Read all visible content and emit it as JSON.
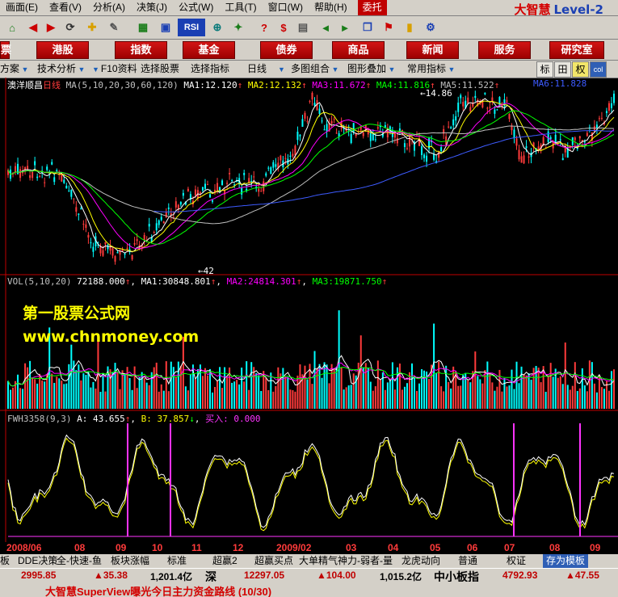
{
  "menu": {
    "items": [
      "画面(E)",
      "查看(V)",
      "分析(A)",
      "决策(J)",
      "公式(W)",
      "工具(T)",
      "窗口(W)",
      "帮助(H)"
    ],
    "entrust": "委托",
    "logo": "大智慧",
    "logo_level": "Level-2"
  },
  "toolbar": {
    "rsi_label": "RSI"
  },
  "navbar": {
    "left_stub": "票",
    "buttons": [
      "港股",
      "指数",
      "基金",
      "债券",
      "商品",
      "新闻",
      "服务",
      "研究室"
    ]
  },
  "function_bar": {
    "items": [
      "方案",
      "技术分析",
      "F10资料",
      "选择股票",
      "选择指标",
      "日线",
      "多图组合",
      "图形叠加",
      "常用指标"
    ],
    "buttons": [
      "标",
      "田",
      "权",
      "col"
    ]
  },
  "chart": {
    "stock_name": "澳洋顺昌",
    "period": "日线",
    "ma_params": "MA(5,10,20,30,60,120)",
    "ma_values": [
      {
        "label": "MA1:",
        "value": "12.120",
        "color": "#ffffff"
      },
      {
        "label": "MA2:",
        "value": "12.132",
        "color": "#ffff00"
      },
      {
        "label": "MA3:",
        "value": "11.672",
        "color": "#ff00ff"
      },
      {
        "label": "MA4:",
        "value": "11.816",
        "color": "#00ff00"
      },
      {
        "label": "MA5:",
        "value": "11.522",
        "color": "#c0c0c0"
      },
      {
        "label": "MA6:",
        "value": "11.828",
        "color": "#3d5bff"
      }
    ],
    "price_high_label": "14.86",
    "price_low_label": "42",
    "vol": {
      "params": "VOL(5,10,20)",
      "value": "72188.000",
      "ma1_label": "MA1:",
      "ma1": "30848.801",
      "ma2_label": "MA2:",
      "ma2": "24814.301",
      "ma3_label": "MA3:",
      "ma3": "19871.750"
    },
    "fwh": {
      "params": "FWH3358(9,3)",
      "a_label": "A:",
      "a": "43.655",
      "b_label": "B:",
      "b": "37.857",
      "buy_label": "买入:",
      "buy": "0.000"
    },
    "watermark_title": "第一股票公式网",
    "watermark_url": "www.chnmoney.com",
    "date_labels": [
      "2008/06",
      "08",
      "09",
      "10",
      "11",
      "12",
      "2009/02",
      "03",
      "04",
      "05",
      "06",
      "07",
      "08",
      "09"
    ],
    "colors": {
      "up": "#ff3b3b",
      "down": "#00ffff",
      "ma1": "#ffffff",
      "ma2": "#ffff00",
      "ma3": "#ff00ff",
      "ma4": "#00ff00",
      "ma5": "#c0c0c0",
      "ma6": "#3d5bff",
      "signal": "#ff33ff"
    }
  },
  "tabs": {
    "items": [
      "板",
      "DDE决策",
      "全-快速-鱼",
      "板块涨幅",
      "标准",
      "超赢2",
      "超赢买点",
      "大单精气神力-弱者-量",
      "龙虎动向",
      "普通",
      "权证"
    ],
    "active": "存为模板"
  },
  "status": {
    "sh_index": "2995.85",
    "sh_change": "▲35.38",
    "sh_amount": "1,201.4亿",
    "sz_label": "深",
    "sz_index": "12297.05",
    "sz_change": "▲104.00",
    "sz_amount": "1,015.2亿",
    "sme_label": "中小板指",
    "sme_index": "4792.93",
    "sme_change": "▲47.55"
  },
  "ticker": {
    "text": "大智慧SuperView曝光今日主力资金路线 (10/30)"
  }
}
